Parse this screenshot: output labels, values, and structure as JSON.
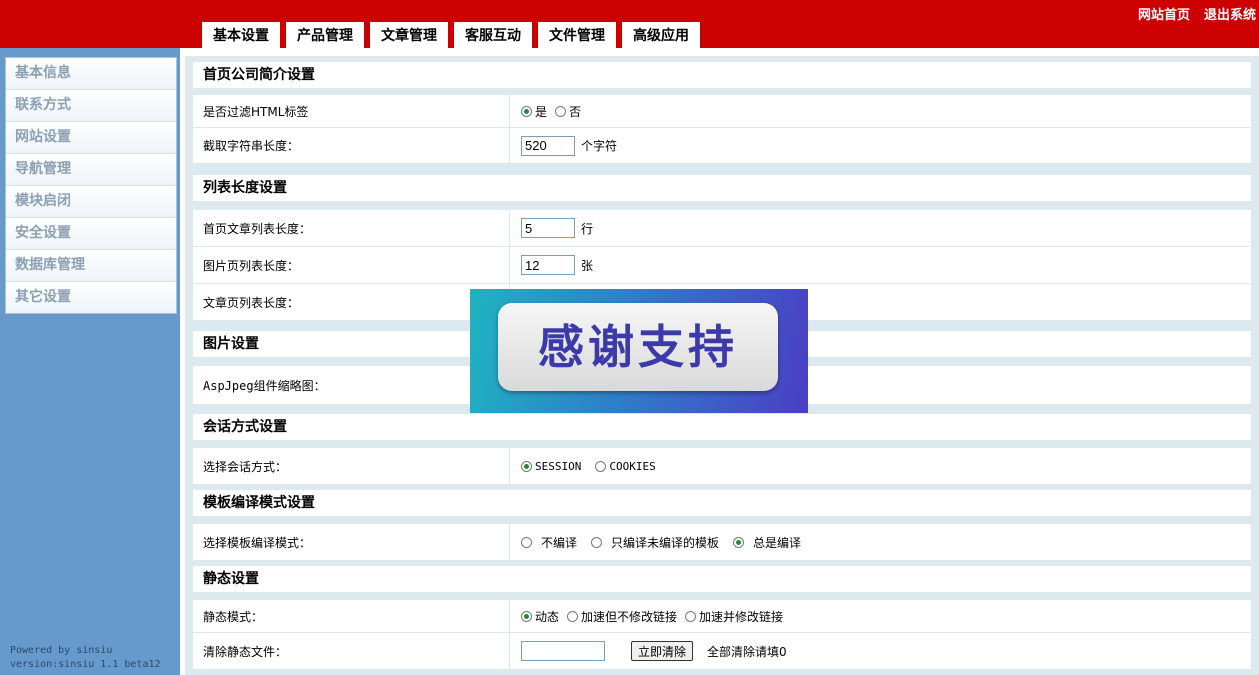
{
  "header": {
    "links": [
      "网站首页",
      "退出系统"
    ],
    "tabs": [
      "基本设置",
      "产品管理",
      "文章管理",
      "客服互动",
      "文件管理",
      "高级应用"
    ]
  },
  "sidebar": {
    "items": [
      "基本信息",
      "联系方式",
      "网站设置",
      "导航管理",
      "模块启闭",
      "安全设置",
      "数据库管理",
      "其它设置"
    ],
    "footer": [
      "Powered by sinsiu",
      "version:sinsiu 1.1 beta12"
    ]
  },
  "sections": {
    "intro": {
      "title": "首页公司简介设置",
      "filter_label": "是否过滤HTML标签",
      "filter_yes": "是",
      "filter_no": "否",
      "length_label": "截取字符串长度：",
      "length_value": "520",
      "length_unit": "个字符"
    },
    "list": {
      "title": "列表长度设置",
      "home_label": "首页文章列表长度：",
      "home_value": "5",
      "home_unit": "行",
      "pic_label": "图片页列表长度：",
      "pic_value": "12",
      "pic_unit": "张",
      "article_label": "文章页列表长度："
    },
    "image": {
      "title": "图片设置",
      "aspjpeg_label": "AspJpeg组件缩略图："
    },
    "session": {
      "title": "会话方式设置",
      "label": "选择会话方式：",
      "opt_session": "SESSION",
      "opt_cookies": "COOKIES"
    },
    "template": {
      "title": "模板编译模式设置",
      "label": "选择模板编译模式：",
      "opt_none": "不编译",
      "opt_partial": "只编译未编译的模板",
      "opt_always": "总是编译"
    },
    "static": {
      "title": "静态设置",
      "mode_label": "静态模式：",
      "opt_dynamic": "动态",
      "opt_fast_no_link": "加速但不修改链接",
      "opt_fast_link": "加速并修改链接",
      "clear_label": "清除静态文件：",
      "clear_value": "",
      "clear_button": "立即清除",
      "clear_hint": "全部清除请填0"
    }
  },
  "overlay": {
    "text": "感谢支持"
  }
}
